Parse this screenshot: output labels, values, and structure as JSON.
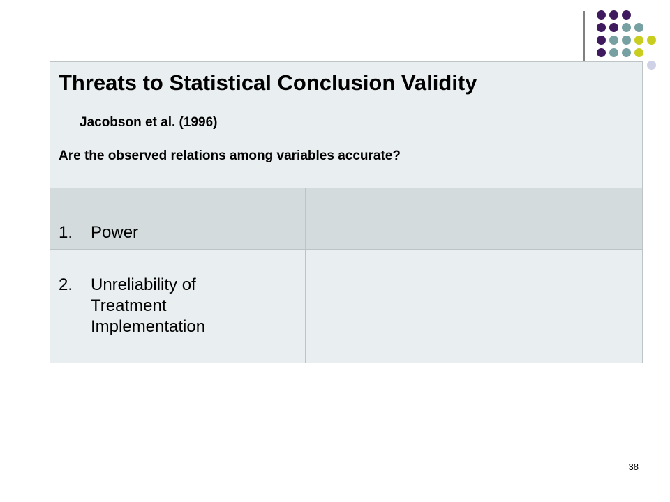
{
  "slide": {
    "title": "Threats to Statistical Conclusion Validity",
    "subtitle": "Jacobson et al. (1996)",
    "question": "Are the observed relations among variables accurate?",
    "rows": [
      {
        "number": "1.",
        "label": "Power",
        "note": ""
      },
      {
        "number": "2.",
        "label": "Unreliability of\nTreatment\nImplementation",
        "note": ""
      }
    ],
    "page_number": "38"
  },
  "decoration": {
    "colors": {
      "purple": "#3f1a5e",
      "teal": "#77a0a3",
      "yellow": "#c8cd1f",
      "lavender": "#cfd1e6"
    }
  }
}
